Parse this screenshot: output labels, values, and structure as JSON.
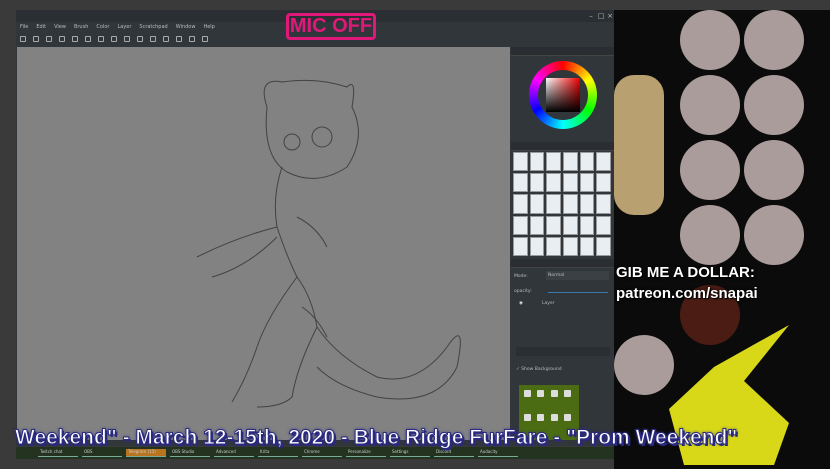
{
  "overlay": {
    "mic_status": "MIC OFF",
    "donation_line1": "GIB ME A DOLLAR:",
    "donation_line2": "patreon.com/snapai",
    "ticker": "Weekend\" - March 12-15th, 2020 - Blue Ridge FurFare - \"Prom Weekend\""
  },
  "krita": {
    "menu": [
      "File",
      "Edit",
      "View",
      "Brush",
      "Color",
      "Layer",
      "Scratchpad",
      "Window",
      "Help"
    ],
    "layers": {
      "mode_label": "Mode:",
      "mode_value": "Normal",
      "opacity_label": "opacity:",
      "opacity": 0.95,
      "layer_name": "Layer",
      "show_background": "Show Background"
    }
  },
  "taskbar": {
    "tasks": [
      "Twitch chat",
      "OBS",
      "Telegram (15)",
      "OBS Studio",
      "Advanced",
      "Krita",
      "Chrome",
      "Personalize",
      "Settings",
      "Discord",
      "Audacity"
    ]
  }
}
